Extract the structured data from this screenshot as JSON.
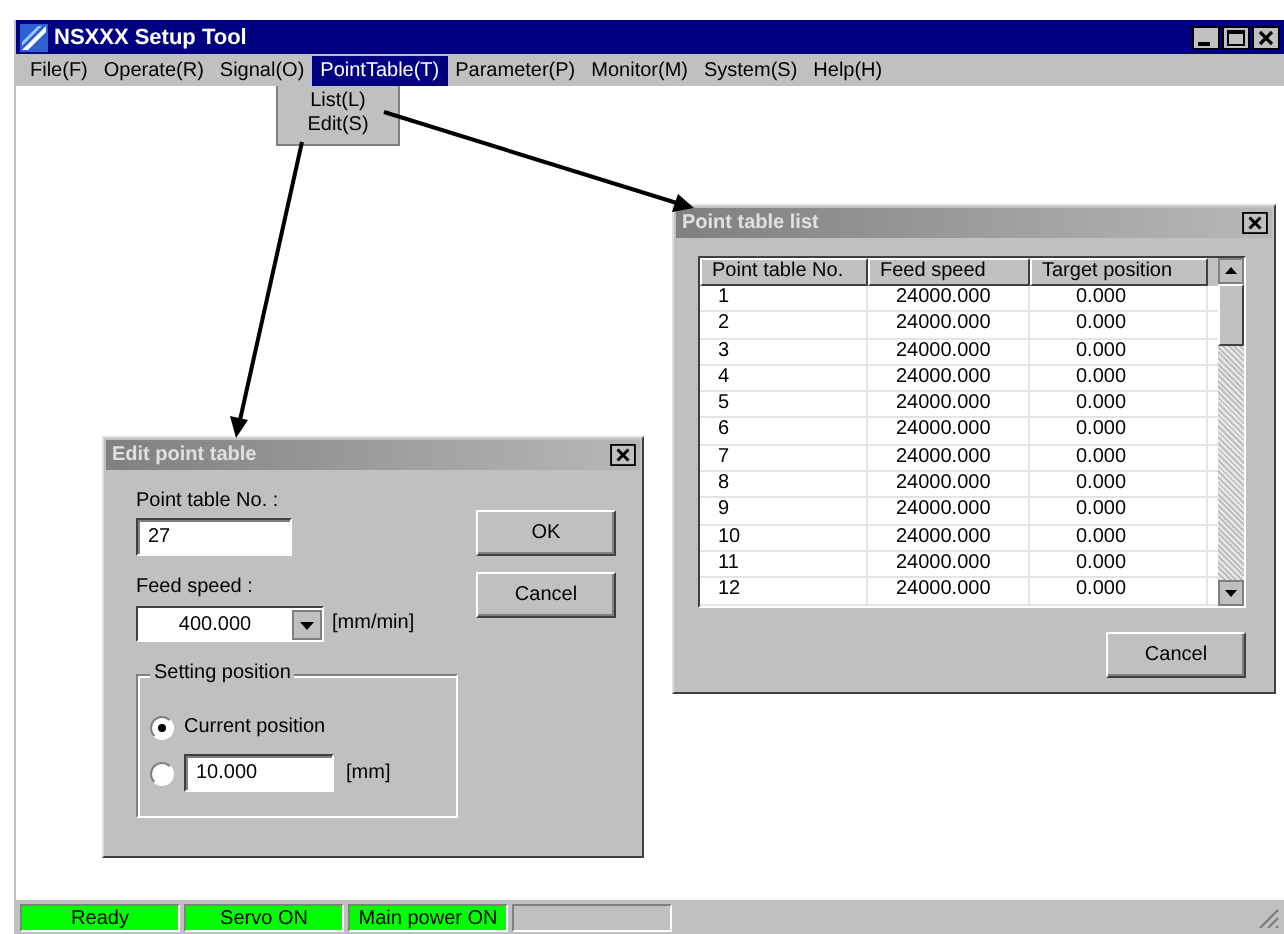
{
  "window": {
    "title": "NSXXX Setup Tool"
  },
  "menu": [
    {
      "label": "File(F)",
      "selected": false
    },
    {
      "label": "Operate(R)",
      "selected": false
    },
    {
      "label": "Signal(O)",
      "selected": false
    },
    {
      "label": "PointTable(T)",
      "selected": true
    },
    {
      "label": "Parameter(P)",
      "selected": false
    },
    {
      "label": "Monitor(M)",
      "selected": false
    },
    {
      "label": "System(S)",
      "selected": false
    },
    {
      "label": "Help(H)",
      "selected": false
    }
  ],
  "submenu": [
    "List(L)",
    "Edit(S)"
  ],
  "list_dialog": {
    "title": "Point table list",
    "columns": [
      "Point table No.",
      "Feed speed",
      "Target position"
    ],
    "rows": [
      [
        "1",
        "24000.000",
        "0.000"
      ],
      [
        "2",
        "24000.000",
        "0.000"
      ],
      [
        "3",
        "24000.000",
        "0.000"
      ],
      [
        "4",
        "24000.000",
        "0.000"
      ],
      [
        "5",
        "24000.000",
        "0.000"
      ],
      [
        "6",
        "24000.000",
        "0.000"
      ],
      [
        "7",
        "24000.000",
        "0.000"
      ],
      [
        "8",
        "24000.000",
        "0.000"
      ],
      [
        "9",
        "24000.000",
        "0.000"
      ],
      [
        "10",
        "24000.000",
        "0.000"
      ],
      [
        "11",
        "24000.000",
        "0.000"
      ],
      [
        "12",
        "24000.000",
        "0.000"
      ]
    ],
    "cancel": "Cancel"
  },
  "edit_dialog": {
    "title": "Edit point table",
    "number_label": "Point table No. :",
    "number_value": "27",
    "speed_label": "Feed speed :",
    "speed_value": "400.000",
    "speed_unit": "[mm/min]",
    "group_label": "Setting position",
    "options": [
      {
        "label": "Current position",
        "selected": true
      },
      {
        "value": "10.000",
        "unit": "[mm]",
        "selected": false
      }
    ],
    "ok": "OK",
    "cancel": "Cancel"
  },
  "status_bar": [
    {
      "label": "Ready",
      "color": "#00ff00"
    },
    {
      "label": "Servo ON",
      "color": "#00ff00"
    },
    {
      "label": "Main power ON",
      "color": "#00ff00"
    }
  ]
}
